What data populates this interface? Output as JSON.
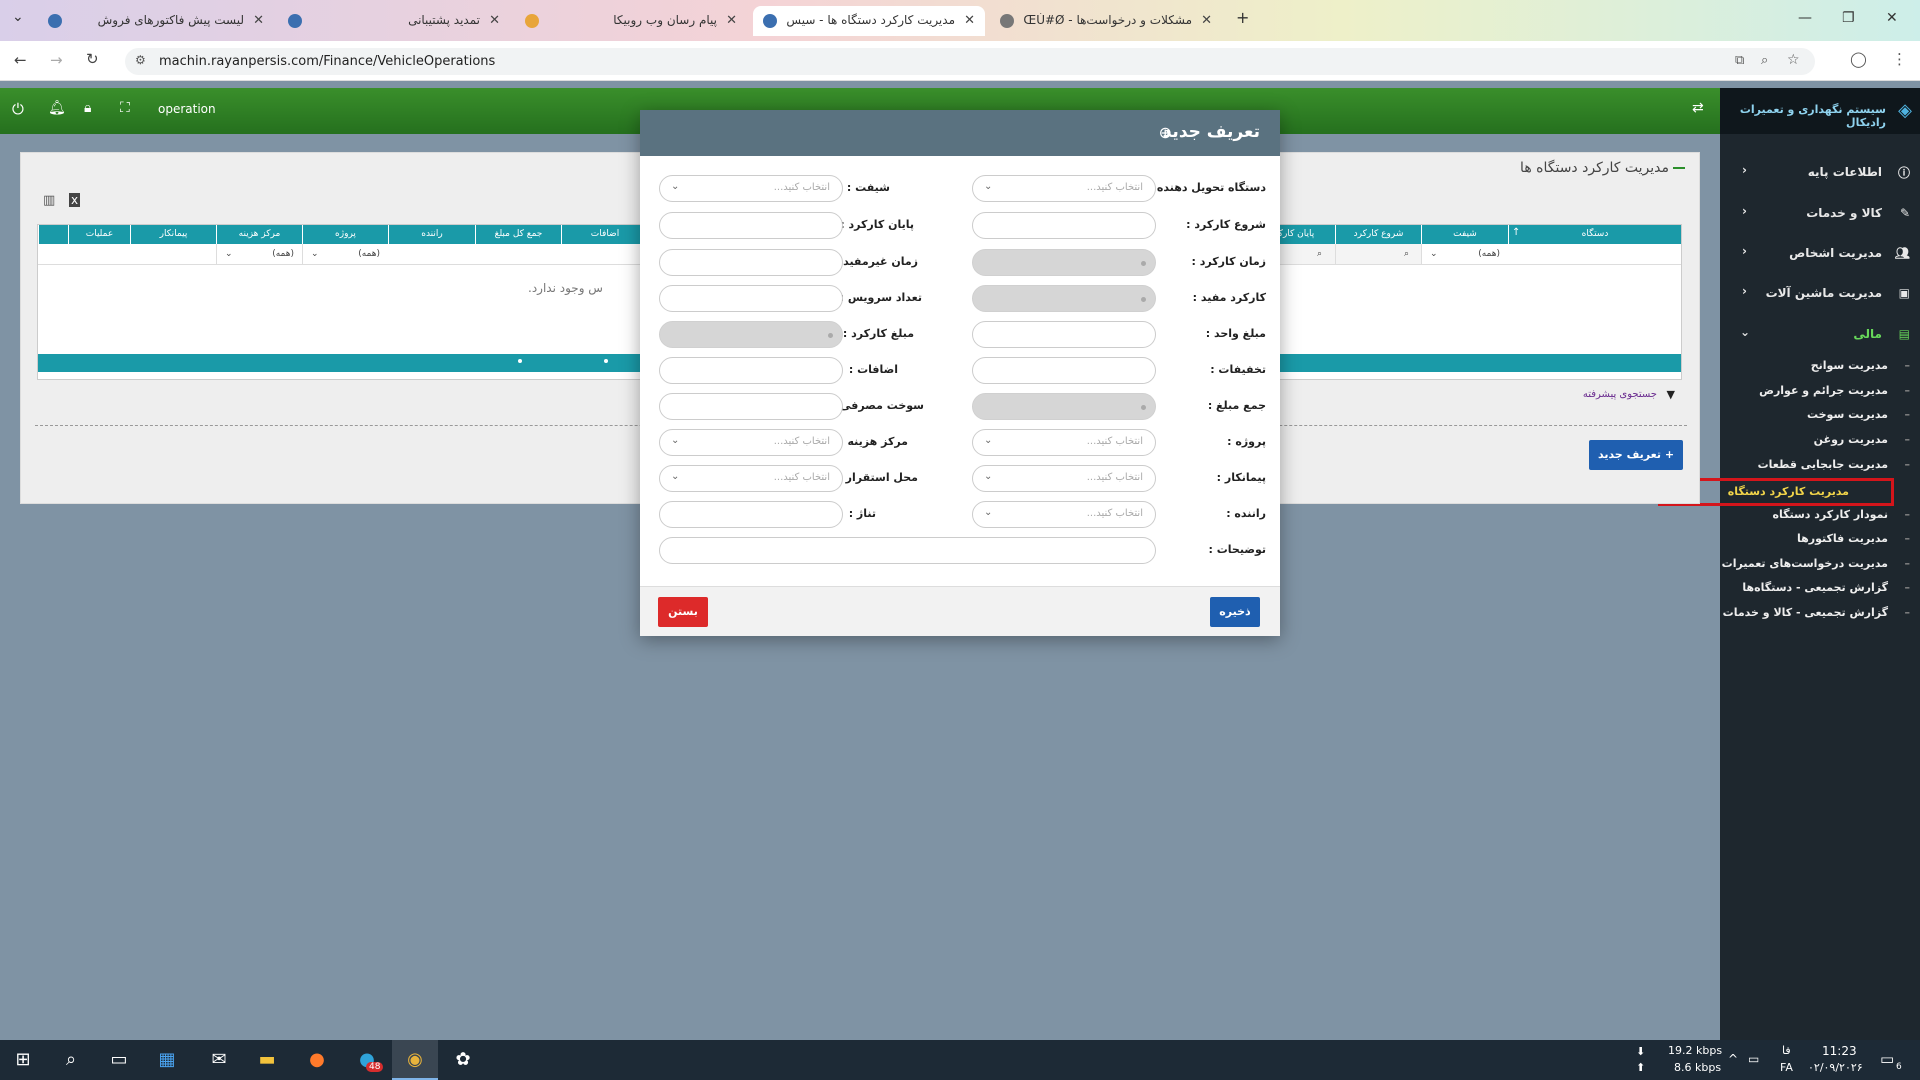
{
  "browser": {
    "tabs": [
      {
        "title": "لیست پیش فاکتورهای فروش"
      },
      {
        "title": "تمدید پشتیبانی"
      },
      {
        "title": "پیام رسان وب روبیکا"
      },
      {
        "title": "مدیریت کارکرد دستگاه ها - سیس..."
      },
      {
        "title": "مشکلات و درخواست‌ها - ÐŒÙ#Ø"
      }
    ],
    "url": "machin.rayanpersis.com/Finance/VehicleOperations"
  },
  "topbar": {
    "user": "operation"
  },
  "sidebar": {
    "brand": "سیستم نگهداری و تعمیرات رادیکال",
    "menu": [
      {
        "label": "اطلاعات پایه",
        "icon": "info-icon"
      },
      {
        "label": "کالا و خدمات",
        "icon": "wrench-icon"
      },
      {
        "label": "مدیریت اشخاص",
        "icon": "users-icon"
      },
      {
        "label": "مدیریت ماشین آلات",
        "icon": "vehicle-icon"
      },
      {
        "label": "مالی",
        "icon": "money-icon"
      }
    ],
    "finance_items": [
      "مدیریت سوانح",
      "مدیریت جرائم و عوارض",
      "مدیریت سوخت",
      "مدیریت روغن",
      "مدیریت جابجایی قطعات",
      "مدیریت کارکرد دستگاه",
      "نمودار کارکرد دستگاه",
      "مدیریت فاکتورها",
      "مدیریت درخواست‌های تعمیرات",
      "گزارش تجمیعی - دستگاه‌ها",
      "گزارش تجمیعی - کالا و خدمات"
    ]
  },
  "page": {
    "title": "مدیریت کارکرد دستگاه ها",
    "grid_headers": [
      "دستگاه",
      "شیفت",
      "شروع کارکرد",
      "پایان کارکرد",
      "اضافات",
      "جمع کل مبلغ",
      "راننده",
      "پروژه",
      "مرکز هزینه",
      "پیمانکار",
      "عملیات"
    ],
    "filter_all": "(همه)",
    "empty_text": "س وجود ندارد.",
    "advanced_search": "جستجوی پیشرفته",
    "new_button": "تعریف جدید"
  },
  "modal": {
    "title": "تعریف جدید",
    "placeholder": "انتخاب کنید...",
    "labels": {
      "delivering_device": "دستگاه تحویل دهنده :",
      "shift": "شیفت :",
      "start": "شروع کارکرد :",
      "end": "پایان کارکرد :",
      "work_time": "زمان کارکرد :",
      "idle_time": "زمان غیرمفید :",
      "useful_work": "کارکرد مفید :",
      "service_count": "تعداد سرویس :",
      "unit_price": "مبلغ واحد :",
      "work_amount": "مبلغ کارکرد :",
      "discounts": "تخفیفات :",
      "additions": "اضافات :",
      "total": "جمع مبلغ :",
      "fuel": "سوخت مصرفی :",
      "project": "پروژه :",
      "cost_center": "مرکز هزینه :",
      "contractor": "پیمانکار :",
      "location": "محل استقرار :",
      "driver": "راننده :",
      "tonnage": "تناژ :",
      "notes": "توضیحات :"
    },
    "save": "ذخیره",
    "close": "بستن"
  },
  "taskbar": {
    "net_down": "19.2 kbps",
    "net_up": "8.6 kbps",
    "lang": "فا",
    "lang2": "FA",
    "time": "11:23",
    "date": "۰۲/۰۹/۲۰۲۶",
    "badge_telegram": "48",
    "notif_count": "6"
  }
}
